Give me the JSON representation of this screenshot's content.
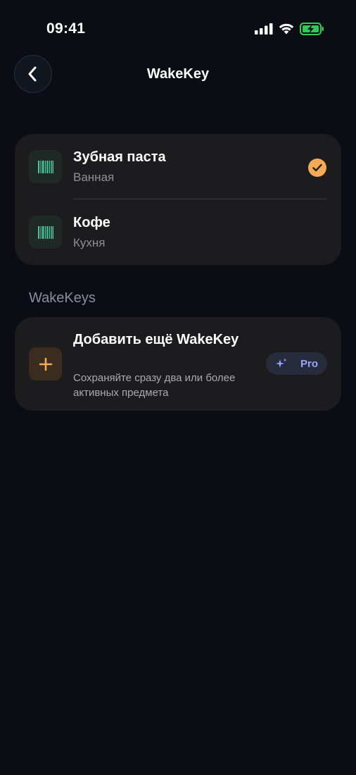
{
  "status_bar": {
    "time": "09:41"
  },
  "nav": {
    "title": "WakeKey",
    "back_icon": "chevron-left-icon"
  },
  "items": [
    {
      "name": "Зубная паста",
      "location": "Ванная",
      "icon": "barcode-icon",
      "selected": true
    },
    {
      "name": "Кофе",
      "location": "Кухня",
      "icon": "barcode-icon",
      "selected": false
    }
  ],
  "section": {
    "title": "WakeKeys"
  },
  "add_card": {
    "title": "Добавить ещё WakeKey",
    "subtitle": "Сохраняйте сразу два или более активных предмета",
    "icon": "plus-icon",
    "badge_label": "Pro",
    "badge_icon": "sparkle-icon"
  },
  "colors": {
    "background": "#0a0d14",
    "card": "#1c1c1f",
    "accent_orange": "#f5ab55",
    "barcode_green": "#4fc3a0",
    "pro_text": "#9aa3ff",
    "battery_green": "#34c759"
  }
}
